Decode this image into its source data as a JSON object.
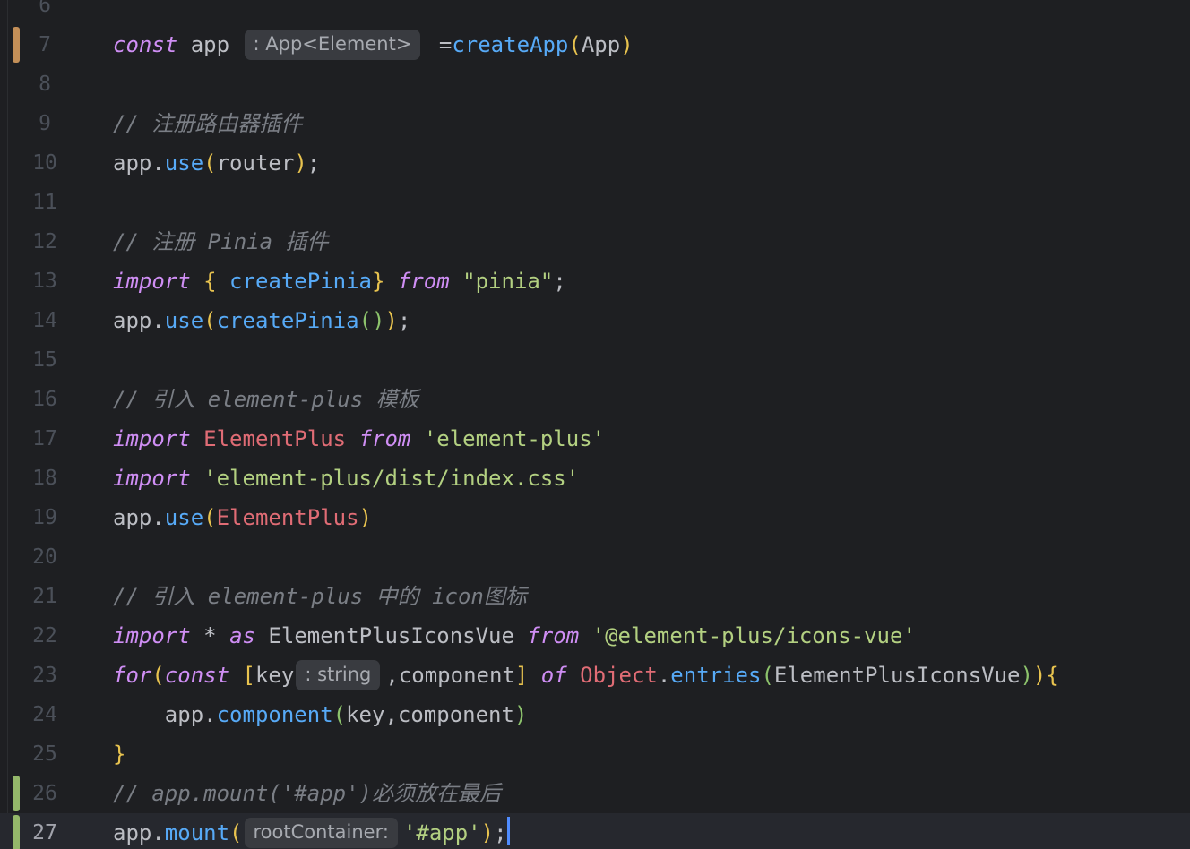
{
  "editor": {
    "lines": [
      {
        "num": "6",
        "tokens": []
      },
      {
        "num": "7",
        "marker": "modified",
        "tokens": [
          {
            "t": "const",
            "c": "kw"
          },
          {
            "t": " app ",
            "c": "ident"
          },
          {
            "hint": ": App<Element>"
          },
          {
            "t": " =",
            "c": "punc"
          },
          {
            "t": "createApp",
            "c": "fn"
          },
          {
            "t": "(",
            "c": "b1"
          },
          {
            "t": "App",
            "c": "ident"
          },
          {
            "t": ")",
            "c": "b1"
          }
        ]
      },
      {
        "num": "8",
        "tokens": []
      },
      {
        "num": "9",
        "tokens": [
          {
            "t": "// 注册路由器插件",
            "c": "cmt"
          }
        ]
      },
      {
        "num": "10",
        "tokens": [
          {
            "t": "app.",
            "c": "ident"
          },
          {
            "t": "use",
            "c": "fn"
          },
          {
            "t": "(",
            "c": "b1"
          },
          {
            "t": "router",
            "c": "ident"
          },
          {
            "t": ")",
            "c": "b1"
          },
          {
            "t": ";",
            "c": "punc"
          }
        ]
      },
      {
        "num": "11",
        "tokens": []
      },
      {
        "num": "12",
        "tokens": [
          {
            "t": "// 注册 Pinia 插件",
            "c": "cmt"
          }
        ]
      },
      {
        "num": "13",
        "tokens": [
          {
            "t": "import",
            "c": "kw"
          },
          {
            "t": " ",
            "c": "punc"
          },
          {
            "t": "{",
            "c": "b1"
          },
          {
            "t": " createPinia",
            "c": "fn"
          },
          {
            "t": "}",
            "c": "b1"
          },
          {
            "t": " ",
            "c": "punc"
          },
          {
            "t": "from",
            "c": "kw"
          },
          {
            "t": " ",
            "c": "punc"
          },
          {
            "t": "\"pinia\"",
            "c": "str"
          },
          {
            "t": ";",
            "c": "punc"
          }
        ]
      },
      {
        "num": "14",
        "tokens": [
          {
            "t": "app.",
            "c": "ident"
          },
          {
            "t": "use",
            "c": "fn"
          },
          {
            "t": "(",
            "c": "b1"
          },
          {
            "t": "createPinia",
            "c": "fn"
          },
          {
            "t": "()",
            "c": "b2"
          },
          {
            "t": ")",
            "c": "b1"
          },
          {
            "t": ";",
            "c": "punc"
          }
        ]
      },
      {
        "num": "15",
        "tokens": []
      },
      {
        "num": "16",
        "tokens": [
          {
            "t": "// 引入 element-plus 模板",
            "c": "cmt"
          }
        ]
      },
      {
        "num": "17",
        "tokens": [
          {
            "t": "import",
            "c": "kw"
          },
          {
            "t": " ",
            "c": "punc"
          },
          {
            "t": "ElementPlus",
            "c": "cls"
          },
          {
            "t": " ",
            "c": "punc"
          },
          {
            "t": "from",
            "c": "kw"
          },
          {
            "t": " ",
            "c": "punc"
          },
          {
            "t": "'element-plus'",
            "c": "str"
          }
        ]
      },
      {
        "num": "18",
        "tokens": [
          {
            "t": "import",
            "c": "kw"
          },
          {
            "t": " ",
            "c": "punc"
          },
          {
            "t": "'element-plus/dist/index.css'",
            "c": "str"
          }
        ]
      },
      {
        "num": "19",
        "tokens": [
          {
            "t": "app.",
            "c": "ident"
          },
          {
            "t": "use",
            "c": "fn"
          },
          {
            "t": "(",
            "c": "b1"
          },
          {
            "t": "ElementPlus",
            "c": "cls"
          },
          {
            "t": ")",
            "c": "b1"
          }
        ]
      },
      {
        "num": "20",
        "tokens": []
      },
      {
        "num": "21",
        "tokens": [
          {
            "t": "// 引入 element-plus 中的 icon图标",
            "c": "cmt"
          }
        ]
      },
      {
        "num": "22",
        "tokens": [
          {
            "t": "import",
            "c": "kw"
          },
          {
            "t": " * ",
            "c": "punc"
          },
          {
            "t": "as",
            "c": "kw"
          },
          {
            "t": " ElementPlusIconsVue ",
            "c": "ident"
          },
          {
            "t": "from",
            "c": "kw"
          },
          {
            "t": " ",
            "c": "punc"
          },
          {
            "t": "'@element-plus/icons-vue'",
            "c": "str"
          }
        ]
      },
      {
        "num": "23",
        "tokens": [
          {
            "t": "for",
            "c": "kw"
          },
          {
            "t": "(",
            "c": "b1"
          },
          {
            "t": "const",
            "c": "kw"
          },
          {
            "t": " ",
            "c": "punc"
          },
          {
            "t": "[",
            "c": "b1"
          },
          {
            "t": "key",
            "c": "ident"
          },
          {
            "hint": ": string"
          },
          {
            "t": ",component",
            "c": "ident"
          },
          {
            "t": "]",
            "c": "b1"
          },
          {
            "t": " ",
            "c": "punc"
          },
          {
            "t": "of",
            "c": "kw"
          },
          {
            "t": " ",
            "c": "punc"
          },
          {
            "t": "Object",
            "c": "cls"
          },
          {
            "t": ".",
            "c": "punc"
          },
          {
            "t": "entries",
            "c": "fn"
          },
          {
            "t": "(",
            "c": "b2"
          },
          {
            "t": "ElementPlusIconsVue",
            "c": "ident"
          },
          {
            "t": ")",
            "c": "b2"
          },
          {
            "t": ")",
            "c": "b1"
          },
          {
            "t": "{",
            "c": "b1"
          }
        ]
      },
      {
        "num": "24",
        "tokens": [
          {
            "t": "    app.",
            "c": "ident"
          },
          {
            "t": "component",
            "c": "fn"
          },
          {
            "t": "(",
            "c": "b2"
          },
          {
            "t": "key,component",
            "c": "ident"
          },
          {
            "t": ")",
            "c": "b2"
          }
        ]
      },
      {
        "num": "25",
        "tokens": [
          {
            "t": "}",
            "c": "b1"
          }
        ]
      },
      {
        "num": "26",
        "marker": "added",
        "tokens": [
          {
            "t": "// app.mount('#app')必须放在最后",
            "c": "cmt"
          }
        ]
      },
      {
        "num": "27",
        "marker": "added",
        "current": true,
        "tokens": [
          {
            "t": "app.",
            "c": "ident"
          },
          {
            "t": "mount",
            "c": "fn"
          },
          {
            "t": "(",
            "c": "b1"
          },
          {
            "hint": "rootContainer:"
          },
          {
            "t": "'#app'",
            "c": "str"
          },
          {
            "t": ")",
            "c": "b1"
          },
          {
            "t": ";",
            "c": "punc"
          },
          {
            "caret": true
          }
        ]
      }
    ]
  }
}
